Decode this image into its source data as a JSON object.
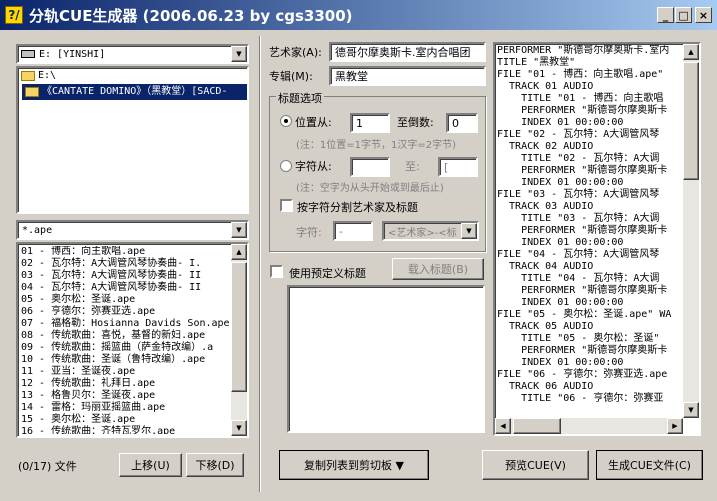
{
  "window": {
    "title": "分轨CUE生成器 (2006.06.23 by cgs3300)",
    "icon": "app-icon",
    "min": "_",
    "max": "□",
    "close": "×"
  },
  "left": {
    "drive": "E: [YINSHI]",
    "folders": [
      "E:\\",
      "《CANTATE DOMINO》（黑教堂）[SACD-"
    ],
    "filter": "*.ape",
    "files": [
      "01 - 博西：向主歌唱.ape",
      "02 - 瓦尔特：A大调管风琴协奏曲- I.",
      "03 - 瓦尔特：A大调管风琴协奏曲- II",
      "04 - 瓦尔特：A大调管风琴协奏曲- II",
      "05 - 奥尔松：圣诞.ape",
      "06 - 亨德尔：弥赛亚选.ape",
      "07 - 福格勒：Hosianna Davids Son.ape",
      "08 - 传统歌曲：喜悦，基督的新妇.ape",
      "09 - 传统歌曲：摇篮曲（萨金特改编）.a",
      "10 - 传统歌曲：圣诞（鲁特改编）.ape",
      "11 - 亚当：圣诞夜.ape",
      "12 - 传统歌曲：礼拜日.ape",
      "13 - 格鲁贝尔：圣诞夜.ape",
      "14 - 雷格：玛丽亚摇篮曲.ape",
      "15 - 奥尔松：圣诞.ape",
      "16 - 传统歌曲：齐特瓦罗尔.ape"
    ],
    "count": "(0/17) 文件",
    "up": "上移(U)",
    "down": "下移(D)"
  },
  "middle": {
    "artist_label": "艺术家(A):",
    "artist_value": "德哥尔摩奥斯卡.室内合唱团",
    "album_label": "专辑(M):",
    "album_value": "黑教堂",
    "title_group": "标题选项",
    "pos_from": "位置从:",
    "pos_from_val": "1",
    "reverse": "至倒数:",
    "reverse_val": "0",
    "pos_note": "(注：1位置=1字节，1汉字=2字节)",
    "char_from": "字符从:",
    "char_to": "至:",
    "char_to_val": "[",
    "char_note": "(注：空字为从头开始或到最后止)",
    "split_label": "按字符分割艺术家及标题",
    "char_label": "字符:",
    "char_val": "-",
    "split_combo": "<艺术家>-<标",
    "predef_label": "使用预定义标题",
    "load_title": "载入标题(B)",
    "copy_list": "复制列表到剪切板 ▼"
  },
  "right": {
    "cue": [
      "PERFORMER \"斯德哥尔摩奥斯卡.室内",
      "TITLE \"黑教堂\"",
      "FILE \"01 - 博西：向主歌唱.ape\"",
      "  TRACK 01 AUDIO",
      "    TITLE \"01 - 博西：向主歌唱",
      "    PERFORMER \"斯德哥尔摩奥斯卡",
      "    INDEX 01 00:00:00",
      "FILE \"02 - 瓦尔特：A大调管风琴",
      "  TRACK 02 AUDIO",
      "    TITLE \"02 - 瓦尔特：A大调",
      "    PERFORMER \"斯德哥尔摩奥斯卡",
      "    INDEX 01 00:00:00",
      "FILE \"03 - 瓦尔特：A大调管风琴",
      "  TRACK 03 AUDIO",
      "    TITLE \"03 - 瓦尔特：A大调",
      "    PERFORMER \"斯德哥尔摩奥斯卡",
      "    INDEX 01 00:00:00",
      "FILE \"04 - 瓦尔特：A大调管风琴",
      "  TRACK 04 AUDIO",
      "    TITLE \"04 - 瓦尔特：A大调",
      "    PERFORMER \"斯德哥尔摩奥斯卡",
      "    INDEX 01 00:00:00",
      "FILE \"05 - 奥尔松：圣诞.ape\" WA",
      "  TRACK 05 AUDIO",
      "    TITLE \"05 - 奥尔松：圣诞\"",
      "    PERFORMER \"斯德哥尔摩奥斯卡",
      "    INDEX 01 00:00:00",
      "FILE \"06 - 亨德尔：弥赛亚选.ape",
      "  TRACK 06 AUDIO",
      "    TITLE \"06 - 亨德尔：弥赛亚"
    ],
    "preview": "预览CUE(V)",
    "generate": "生成CUE文件(C)"
  }
}
